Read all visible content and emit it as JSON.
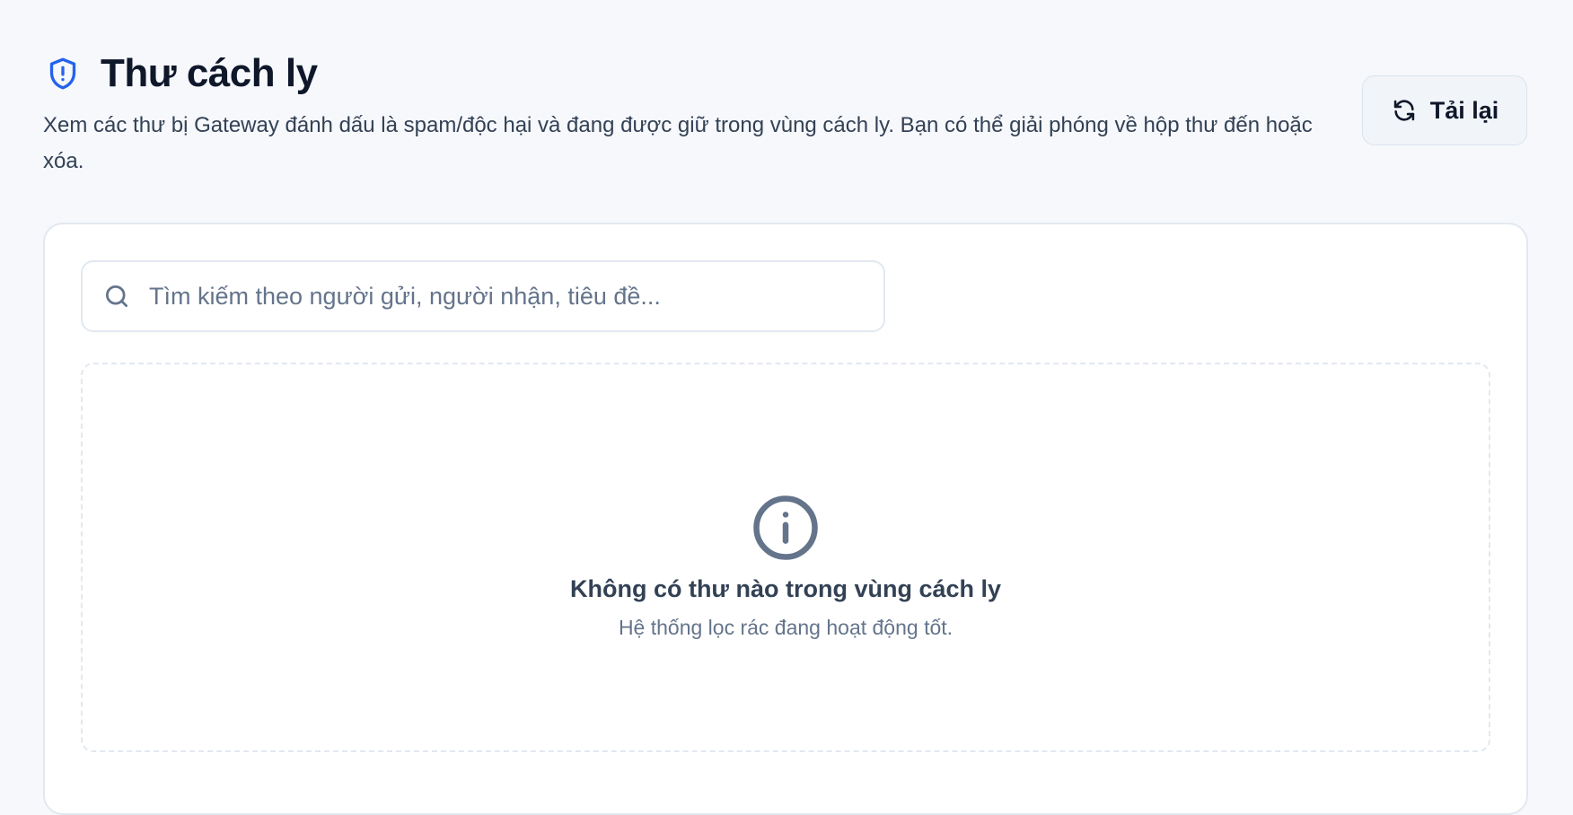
{
  "header": {
    "icon": "shield-alert-icon",
    "title": "Thư cách ly",
    "subtitle": "Xem các thư bị Gateway đánh dấu là spam/độc hại và đang được giữ trong vùng cách ly. Bạn có thể giải phóng về hộp thư đến hoặc xóa."
  },
  "toolbar": {
    "reload_icon": "refresh-icon",
    "reload_label": "Tải lại"
  },
  "search": {
    "icon": "search-icon",
    "placeholder": "Tìm kiếm theo người gửi, người nhận, tiêu đề...",
    "value": ""
  },
  "empty_state": {
    "icon": "info-icon",
    "title": "Không có thư nào trong vùng cách ly",
    "message": "Hệ thống lọc rác đang hoạt động tốt."
  },
  "colors": {
    "accent": "#2563eb",
    "background": "#f6f8fb",
    "muted_icon": "#64748b"
  }
}
